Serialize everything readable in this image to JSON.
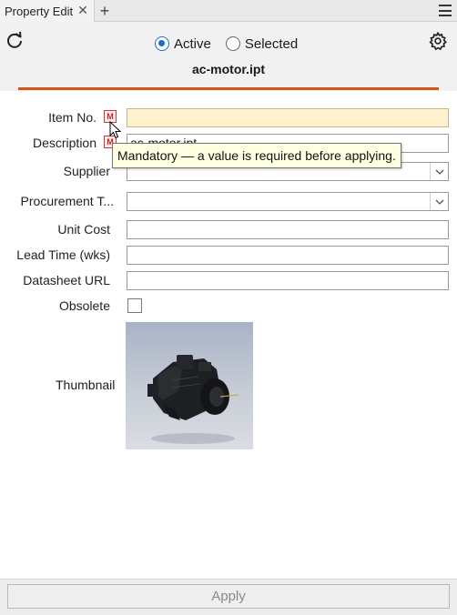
{
  "tab": {
    "title": "Property Edit",
    "close_glyph": "✕",
    "add_glyph": "+"
  },
  "header": {
    "scope_options": [
      {
        "label": "Active",
        "selected": true
      },
      {
        "label": "Selected",
        "selected": false
      }
    ],
    "filename": "ac-motor.ipt",
    "accent_color": "#d2541a"
  },
  "fields": [
    {
      "label": "Item No.",
      "value": "",
      "required": true,
      "type": "text"
    },
    {
      "label": "Description",
      "value": "ac-motor.ipt",
      "required": true,
      "type": "text"
    },
    {
      "label": "Supplier",
      "value": "",
      "type": "select"
    },
    {
      "label": "Procurement T...",
      "value": "",
      "type": "select"
    },
    {
      "label": "Unit Cost",
      "value": "",
      "type": "text"
    },
    {
      "label": "Lead Time (wks)",
      "value": "",
      "type": "text"
    },
    {
      "label": "Datasheet URL",
      "value": "",
      "type": "text"
    },
    {
      "label": "Obsolete",
      "checked": false,
      "type": "checkbox"
    }
  ],
  "mandatory_badge": "M",
  "tooltip": "Mandatory — a value is required before applying.",
  "thumbnail": {
    "label": "Thumbnail"
  },
  "footer": {
    "apply_label": "Apply",
    "apply_enabled": false
  }
}
